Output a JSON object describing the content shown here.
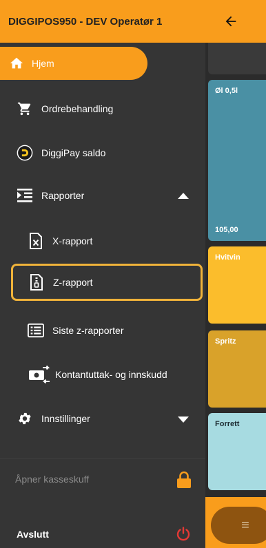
{
  "drawer": {
    "title": "DIGGIPOS950 - DEV Operatør 1",
    "items": {
      "home": "Hjem",
      "orders": "Ordrebehandling",
      "diggipay": "DiggiPay saldo",
      "reports": "Rapporter",
      "x_report": "X-rapport",
      "z_report": "Z-rapport",
      "latest_z_reports": "Siste z-rapporter",
      "cash": "Kontantuttak- og innskudd",
      "settings": "Innstillinger",
      "open_drawer": "Åpner kasseskuff",
      "exit": "Avslutt"
    },
    "selected": "z_report"
  },
  "tiles": [
    {
      "name": "Øl 0,5l",
      "price": "105,00"
    },
    {
      "name": "Hvitvin"
    },
    {
      "name": "Spritz"
    },
    {
      "name": "Forrett"
    }
  ],
  "icons": {
    "back": "arrow-left-icon",
    "menu": "hamburger-icon",
    "home": "home-icon",
    "orders": "cart-icon",
    "diggipay": "diggipay-logo-icon",
    "reports": "report-list-icon",
    "x_report": "x-document-icon",
    "z_report": "z-document-icon",
    "latest_z_reports": "list-icon",
    "cash": "cash-transfer-icon",
    "settings": "gear-icon",
    "lock": "lock-icon",
    "power": "power-icon"
  },
  "colors": {
    "accent": "#f99d1c",
    "drawer_bg": "#353535",
    "highlight_border": "#f0b33a",
    "power": "#e53935"
  }
}
